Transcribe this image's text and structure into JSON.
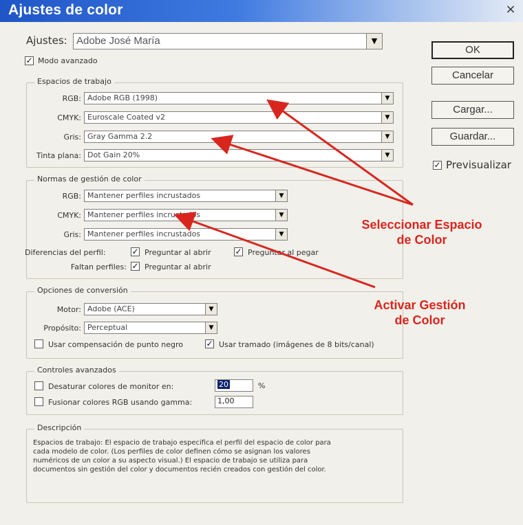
{
  "window": {
    "title": "Ajustes de color",
    "close_glyph": "×"
  },
  "top": {
    "ajustes_label": "Ajustes:",
    "ajustes_value": "Adobe José María",
    "modo_avanzado": {
      "label": "Modo avanzado",
      "checked": true
    }
  },
  "buttons": {
    "ok": "OK",
    "cancel": "Cancelar",
    "load": "Cargar...",
    "save": "Guardar..."
  },
  "preview": {
    "label": "Previsualizar",
    "checked": true
  },
  "espacios": {
    "legend": "Espacios de trabajo",
    "rows": [
      {
        "label": "RGB:",
        "value": "Adobe RGB (1998)"
      },
      {
        "label": "CMYK:",
        "value": "Euroscale Coated v2"
      },
      {
        "label": "Gris:",
        "value": "Gray Gamma 2.2"
      },
      {
        "label": "Tinta plana:",
        "value": "Dot Gain 20%"
      }
    ]
  },
  "normas": {
    "legend": "Normas de gestión de color",
    "rows": [
      {
        "label": "RGB:",
        "value": "Mantener perfiles incrustados"
      },
      {
        "label": "CMYK:",
        "value": "Mantener perfiles incrustados"
      },
      {
        "label": "Gris:",
        "value": "Mantener perfiles incrustados"
      }
    ],
    "diferencias_label": "Diferencias del perfil:",
    "preguntar_abrir": "Preguntar al abrir",
    "preguntar_pegar": "Preguntar al pegar",
    "faltan_label": "Faltan perfiles:",
    "faltan_preguntar": "Preguntar al abrir"
  },
  "conversion": {
    "legend": "Opciones de conversión",
    "motor_label": "Motor:",
    "motor_value": "Adobe (ACE)",
    "proposito_label": "Propósito:",
    "proposito_value": "Perceptual",
    "compensacion": {
      "label": "Usar compensación de punto negro",
      "checked": false
    },
    "tramado": {
      "label": "Usar tramado (imágenes de 8 bits/canal)",
      "checked": true
    }
  },
  "avanzados": {
    "legend": "Controles avanzados",
    "desaturar": {
      "label": "Desaturar colores de monitor en:",
      "value": "20",
      "unit": "%",
      "checked": false
    },
    "fusionar": {
      "label": "Fusionar colores RGB usando gamma:",
      "value": "1,00",
      "checked": false
    }
  },
  "descripcion": {
    "legend": "Descripción",
    "text": "Espacios de trabajo: El espacio de trabajo especifica el perfil del espacio de color para\ncada modelo de color. (Los perfiles de color definen cómo se asignan los valores\nnuméricos de un color a su aspecto visual.) El espacio de trabajo se utiliza para\ndocumentos sin gestión del color y documentos recién creados con gestión del color."
  },
  "annotations": {
    "a1_line1": "Seleccionar Espacio",
    "a1_line2": "de Color",
    "a2_line1": "Activar Gestión",
    "a2_line2": "de Color",
    "color": "#d8261f"
  },
  "icons": {
    "check": "✓",
    "dropdown": "▼"
  }
}
